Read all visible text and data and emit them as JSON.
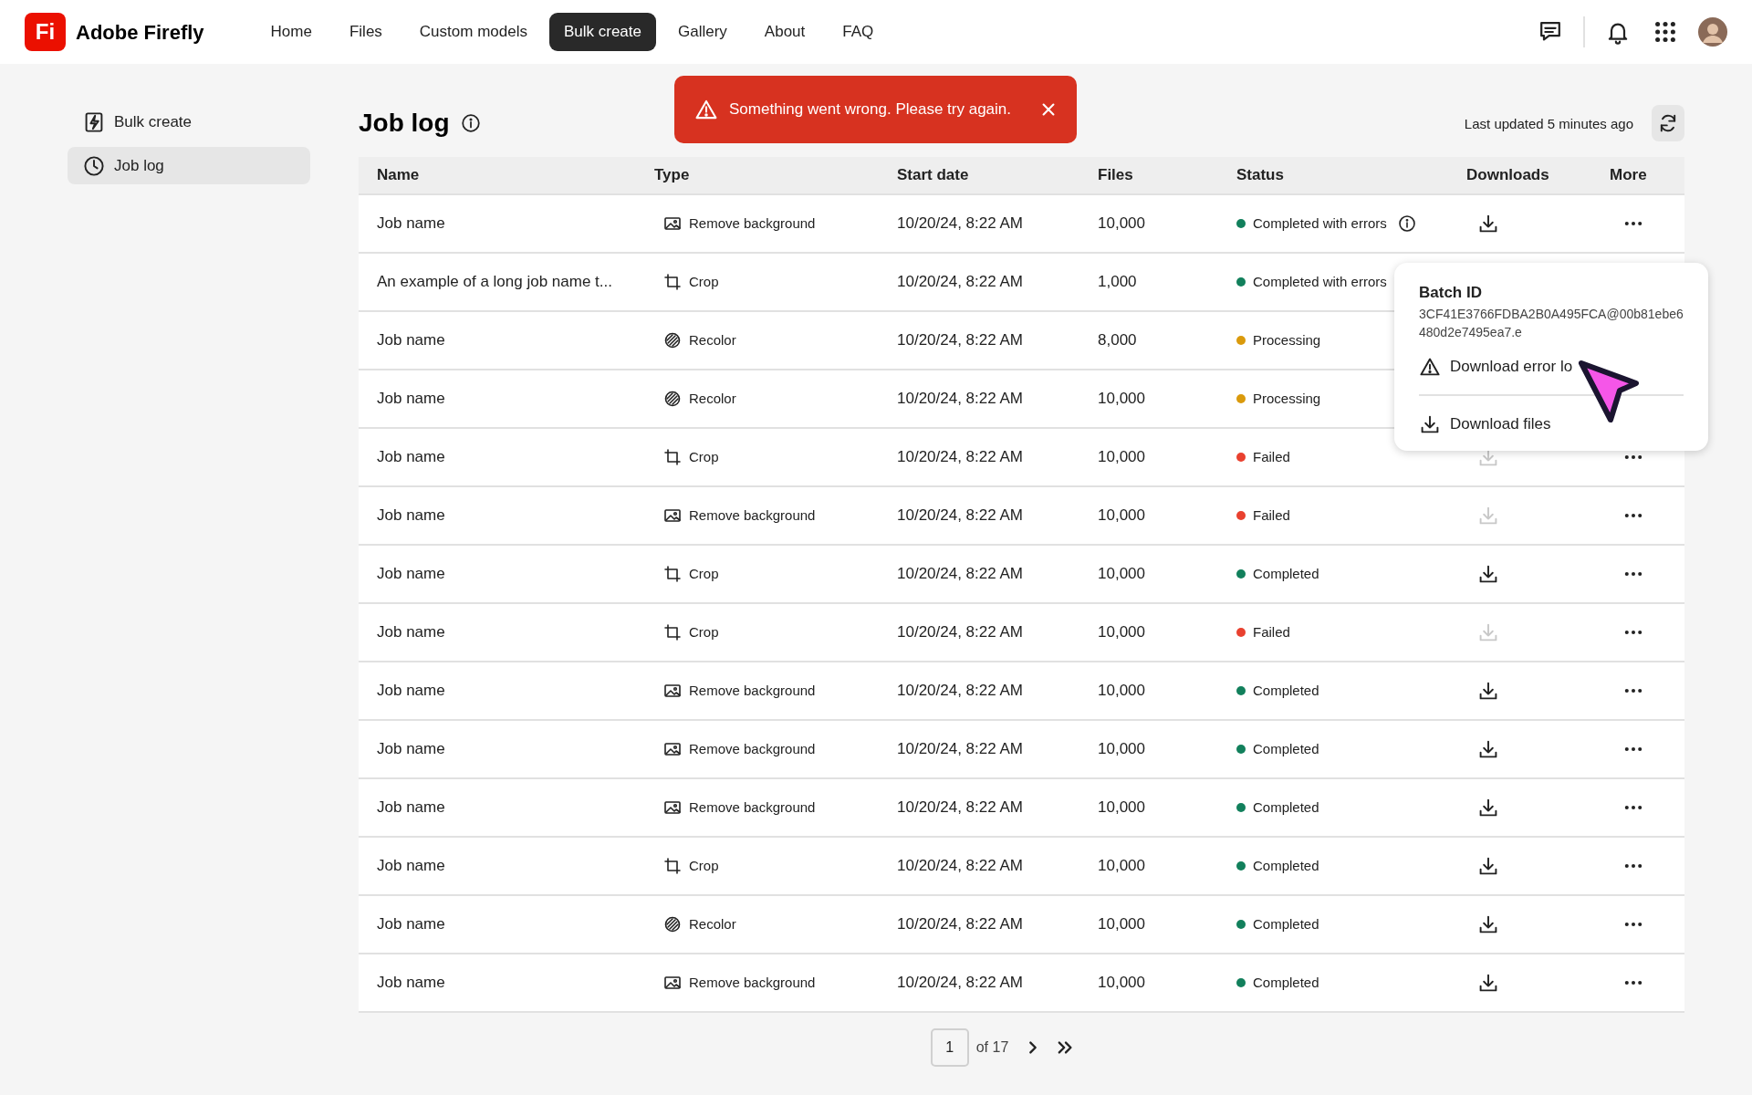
{
  "app": {
    "logo": "Fi",
    "name": "Adobe Firefly"
  },
  "nav": [
    {
      "label": "Home",
      "selected": false
    },
    {
      "label": "Files",
      "selected": false
    },
    {
      "label": "Custom models",
      "selected": false
    },
    {
      "label": "Bulk create",
      "selected": true
    },
    {
      "label": "Gallery",
      "selected": false
    },
    {
      "label": "About",
      "selected": false
    },
    {
      "label": "FAQ",
      "selected": false
    }
  ],
  "sidebar": {
    "items": [
      {
        "label": "Bulk create",
        "kind": "bolt",
        "selected": false
      },
      {
        "label": "Job log",
        "kind": "clock",
        "selected": true
      }
    ]
  },
  "page": {
    "title": "Job log",
    "last_updated": "Last updated 5 minutes ago"
  },
  "toast": {
    "message": "Something went wrong. Please try again."
  },
  "table": {
    "columns": [
      "Name",
      "Type",
      "Start date",
      "Files",
      "Status",
      "Downloads",
      "More"
    ],
    "rows": [
      {
        "name": "Job name",
        "type": "Remove background",
        "kind": "image",
        "start": "10/20/24, 8:22 AM",
        "files": "10,000",
        "status": "Completed with errors",
        "color": "#12805c",
        "info": true,
        "download_enabled": true,
        "more": true
      },
      {
        "name": "An example of a long job name t...",
        "type": "Crop",
        "kind": "crop",
        "start": "10/20/24, 8:22 AM",
        "files": "1,000",
        "status": "Completed with errors",
        "color": "#12805c",
        "info": false
      },
      {
        "name": "Job name",
        "type": "Recolor",
        "kind": "recolor",
        "start": "10/20/24, 8:22 AM",
        "files": "8,000",
        "status": "Processing",
        "color": "#da9a0c",
        "info": false
      },
      {
        "name": "Job name",
        "type": "Recolor",
        "kind": "recolor",
        "start": "10/20/24, 8:22 AM",
        "files": "10,000",
        "status": "Processing",
        "color": "#da9a0c",
        "info": false
      },
      {
        "name": "Job name",
        "type": "Crop",
        "kind": "crop",
        "start": "10/20/24, 8:22 AM",
        "files": "10,000",
        "status": "Failed",
        "color": "#e9412f",
        "info": false,
        "download_enabled": false,
        "more": true
      },
      {
        "name": "Job name",
        "type": "Remove background",
        "kind": "image",
        "start": "10/20/24, 8:22 AM",
        "files": "10,000",
        "status": "Failed",
        "color": "#e9412f",
        "info": false,
        "download_enabled": false,
        "more": true
      },
      {
        "name": "Job name",
        "type": "Crop",
        "kind": "crop",
        "start": "10/20/24, 8:22 AM",
        "files": "10,000",
        "status": "Completed",
        "color": "#12805c",
        "info": false,
        "download_enabled": true,
        "more": true
      },
      {
        "name": "Job name",
        "type": "Crop",
        "kind": "crop",
        "start": "10/20/24, 8:22 AM",
        "files": "10,000",
        "status": "Failed",
        "color": "#e9412f",
        "info": false,
        "download_enabled": false,
        "more": true
      },
      {
        "name": "Job name",
        "type": "Remove background",
        "kind": "image",
        "start": "10/20/24, 8:22 AM",
        "files": "10,000",
        "status": "Completed",
        "color": "#12805c",
        "info": false,
        "download_enabled": true,
        "more": true
      },
      {
        "name": "Job name",
        "type": "Remove background",
        "kind": "image",
        "start": "10/20/24, 8:22 AM",
        "files": "10,000",
        "status": "Completed",
        "color": "#12805c",
        "info": false,
        "download_enabled": true,
        "more": true
      },
      {
        "name": "Job name",
        "type": "Remove background",
        "kind": "image",
        "start": "10/20/24, 8:22 AM",
        "files": "10,000",
        "status": "Completed",
        "color": "#12805c",
        "info": false,
        "download_enabled": true,
        "more": true
      },
      {
        "name": "Job name",
        "type": "Crop",
        "kind": "crop",
        "start": "10/20/24, 8:22 AM",
        "files": "10,000",
        "status": "Completed",
        "color": "#12805c",
        "info": false,
        "download_enabled": true,
        "more": true
      },
      {
        "name": "Job name",
        "type": "Recolor",
        "kind": "recolor",
        "start": "10/20/24, 8:22 AM",
        "files": "10,000",
        "status": "Completed",
        "color": "#12805c",
        "info": false,
        "download_enabled": true,
        "more": true
      },
      {
        "name": "Job name",
        "type": "Remove background",
        "kind": "image",
        "start": "10/20/24, 8:22 AM",
        "files": "10,000",
        "status": "Completed",
        "color": "#12805c",
        "info": false,
        "download_enabled": true,
        "more": true
      }
    ]
  },
  "popover": {
    "title": "Batch ID",
    "id_lines": [
      "3CF41E3766FDBA2B0A495FCA@00b81ebe6",
      "480d2e7495ea7.e"
    ],
    "items": [
      {
        "label": "Download error lo",
        "kind": "warning"
      },
      {
        "label": "Download files",
        "kind": "download"
      }
    ]
  },
  "pagination": {
    "page": "1",
    "of": "of 17"
  }
}
